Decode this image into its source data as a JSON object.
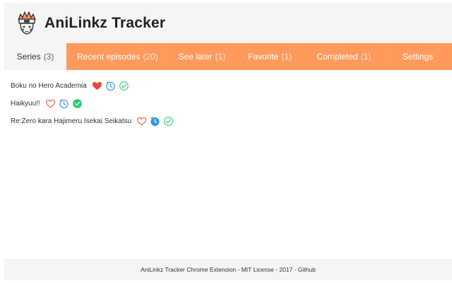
{
  "header": {
    "title": "AniLinkz Tracker",
    "logo_icon": "ninja-head-icon"
  },
  "tabs": [
    {
      "label": "Series",
      "count": "(3)",
      "active": true
    },
    {
      "label": "Recent episodes",
      "count": "(20)",
      "active": false
    },
    {
      "label": "See later",
      "count": "(1)",
      "active": false
    },
    {
      "label": "Favorite",
      "count": "(1)",
      "active": false
    },
    {
      "label": "Completed",
      "count": "(1)",
      "active": false
    },
    {
      "label": "Settings",
      "count": "",
      "active": false
    }
  ],
  "series": [
    {
      "name": "Boku no Hero Academia",
      "favorite": true,
      "see_later": false,
      "completed": false
    },
    {
      "name": "Haikyuu!!",
      "favorite": false,
      "see_later": false,
      "completed": true
    },
    {
      "name": "Re:Zero kara Hajimeru Isekai Seikatsu",
      "favorite": false,
      "see_later": true,
      "completed": false
    }
  ],
  "footer": {
    "text": "AniLinkz Tracker Chrome Extension - MIT License - 2017 - ",
    "link": "Github"
  },
  "colors": {
    "accent": "#ff9a5c",
    "favorite": "#e74c3c",
    "see_later": "#3498db",
    "completed": "#2ecc71"
  }
}
